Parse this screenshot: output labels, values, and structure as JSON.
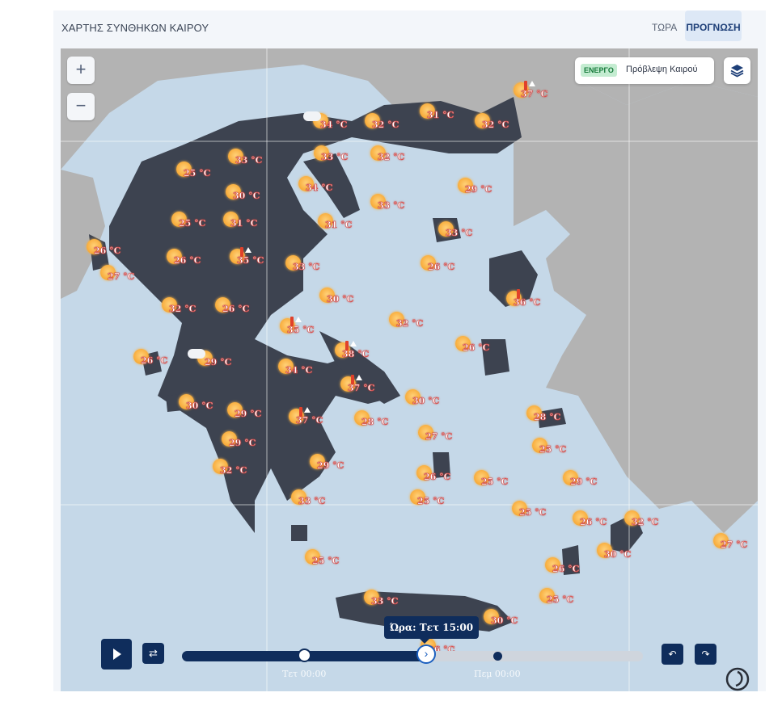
{
  "header": {
    "title": "ΧΑΡΤΗΣ ΣΥΝΘΗΚΩΝ ΚΑΙΡΟΥ",
    "tabs": [
      {
        "label": "ΤΩΡΑ",
        "active": false
      },
      {
        "label": "ΠΡΟΓΝΩΣΗ",
        "active": true
      }
    ]
  },
  "map": {
    "zoom_in": "+",
    "zoom_out": "−",
    "layer_status": "ΕΝΕΡΓΟ",
    "layer_name": "Πρόβλεψη Καιρού",
    "layers_icon": "layers-icon",
    "colors": {
      "sea": "#c5d8e8",
      "greece": "#3d4350",
      "neighbours": "#b3b3b3",
      "sun": "#f7a733",
      "temp_outline": "#d14848"
    },
    "temperatures": [
      {
        "label": "37 °C",
        "marker": "thermometer",
        "warning": true
      },
      {
        "label": "34 °C",
        "marker": "cloud",
        "warning": false
      },
      {
        "label": "32 °C",
        "marker": "sun",
        "warning": false
      },
      {
        "label": "31 °C",
        "marker": "sun",
        "warning": false
      },
      {
        "label": "32 °C",
        "marker": "sun",
        "warning": false
      },
      {
        "label": "33 °C",
        "marker": "sun",
        "warning": false
      },
      {
        "label": "25 °C",
        "marker": "sun",
        "warning": false
      },
      {
        "label": "33 °C",
        "marker": "sun",
        "warning": false
      },
      {
        "label": "32 °C",
        "marker": "sun",
        "warning": false
      },
      {
        "label": "34 °C",
        "marker": "sun",
        "warning": false
      },
      {
        "label": "30 °C",
        "marker": "sun",
        "warning": false
      },
      {
        "label": "29 °C",
        "marker": "sun",
        "warning": false
      },
      {
        "label": "33 °C",
        "marker": "sun",
        "warning": false
      },
      {
        "label": "25 °C",
        "marker": "sun",
        "warning": false
      },
      {
        "label": "31 °C",
        "marker": "sun",
        "warning": false
      },
      {
        "label": "31 °C",
        "marker": "sun",
        "warning": false
      },
      {
        "label": "33 °C",
        "marker": "sun",
        "warning": false
      },
      {
        "label": "26 °C",
        "marker": "sun",
        "warning": false
      },
      {
        "label": "26 °C",
        "marker": "sun",
        "warning": false
      },
      {
        "label": "35 °C",
        "marker": "thermometer",
        "warning": true
      },
      {
        "label": "33 °C",
        "marker": "sun",
        "warning": false
      },
      {
        "label": "26 °C",
        "marker": "sun",
        "warning": false
      },
      {
        "label": "27 °C",
        "marker": "sun",
        "warning": false
      },
      {
        "label": "30 °C",
        "marker": "sun",
        "warning": false
      },
      {
        "label": "36 °C",
        "marker": "thermometer",
        "warning": false
      },
      {
        "label": "32 °C",
        "marker": "sun",
        "warning": false
      },
      {
        "label": "26 °C",
        "marker": "sun",
        "warning": false
      },
      {
        "label": "32 °C",
        "marker": "sun",
        "warning": false
      },
      {
        "label": "35 °C",
        "marker": "thermometer",
        "warning": true
      },
      {
        "label": "26 °C",
        "marker": "sun",
        "warning": false
      },
      {
        "label": "26 °C",
        "marker": "sun",
        "warning": false
      },
      {
        "label": "38 °C",
        "marker": "thermometer",
        "warning": true
      },
      {
        "label": "29 °C",
        "marker": "cloud",
        "warning": false
      },
      {
        "label": "34 °C",
        "marker": "sun",
        "warning": false
      },
      {
        "label": "37 °C",
        "marker": "thermometer",
        "warning": true
      },
      {
        "label": "30 °C",
        "marker": "sun",
        "warning": false
      },
      {
        "label": "30 °C",
        "marker": "sun",
        "warning": false
      },
      {
        "label": "29 °C",
        "marker": "sun",
        "warning": false
      },
      {
        "label": "37 °C",
        "marker": "thermometer",
        "warning": true
      },
      {
        "label": "28 °C",
        "marker": "sun",
        "warning": false
      },
      {
        "label": "28 °C",
        "marker": "sun",
        "warning": false
      },
      {
        "label": "27 °C",
        "marker": "sun",
        "warning": false
      },
      {
        "label": "29 °C",
        "marker": "sun",
        "warning": false
      },
      {
        "label": "25 °C",
        "marker": "sun",
        "warning": false
      },
      {
        "label": "32 °C",
        "marker": "sun",
        "warning": false
      },
      {
        "label": "29 °C",
        "marker": "sun",
        "warning": false
      },
      {
        "label": "26 °C",
        "marker": "sun",
        "warning": false
      },
      {
        "label": "25 °C",
        "marker": "sun",
        "warning": false
      },
      {
        "label": "29 °C",
        "marker": "sun",
        "warning": false
      },
      {
        "label": "33 °C",
        "marker": "sun",
        "warning": false
      },
      {
        "label": "25 °C",
        "marker": "sun",
        "warning": false
      },
      {
        "label": "25 °C",
        "marker": "sun",
        "warning": false
      },
      {
        "label": "26 °C",
        "marker": "sun",
        "warning": false
      },
      {
        "label": "32 °C",
        "marker": "sun",
        "warning": false
      },
      {
        "label": "27 °C",
        "marker": "sun",
        "warning": false
      },
      {
        "label": "30 °C",
        "marker": "sun",
        "warning": false
      },
      {
        "label": "25 °C",
        "marker": "sun",
        "warning": false
      },
      {
        "label": "26 °C",
        "marker": "sun",
        "warning": false
      },
      {
        "label": "25 °C",
        "marker": "sun",
        "warning": false
      },
      {
        "label": "33 °C",
        "marker": "sun",
        "warning": false
      },
      {
        "label": "30 °C",
        "marker": "sun",
        "warning": false
      },
      {
        "label": "26 °C",
        "marker": "sun",
        "warning": false
      }
    ]
  },
  "player": {
    "play_icon": "play-icon",
    "loop_icon": "loop-icon",
    "tooltip": "Ώρα: Τετ 15:00",
    "day_labels": [
      "Τετ 00:00",
      "Πεμ 00:00"
    ],
    "progress_fraction": 0.53,
    "day_marker_fraction": 0.265,
    "prev_icon": "undo-arrow-icon",
    "next_icon": "redo-arrow-icon",
    "logo_icon": "brand-logo-icon"
  }
}
